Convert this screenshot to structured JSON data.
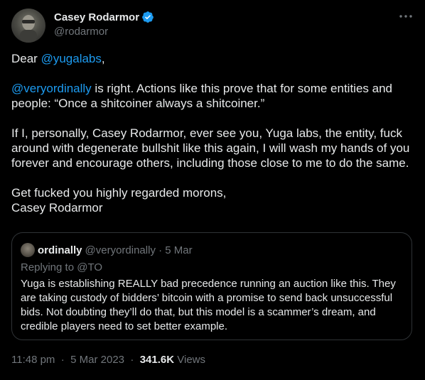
{
  "author": {
    "display_name": "Casey Rodarmor",
    "handle": "@rodarmor",
    "verified_icon": "verified-badge-icon"
  },
  "more_icon": "more-horizontal-icon",
  "tweet": {
    "salutation_prefix": "Dear ",
    "salutation_mention": "@yugalabs",
    "salutation_suffix": ",",
    "para1_mention": "@veryordinally",
    "para1_text": " is right. Actions like this prove that for some entities and people: “Once a shitcoiner always a shitcoiner.”",
    "para2": "If I, personally, Casey Rodarmor, ever see you, Yuga labs, the entity, fuck around with degenerate bullshit like this again, I will wash my hands of you forever and encourage others, including those close to me to do the same.",
    "para3_line1": "Get fucked you highly regarded morons,",
    "para3_line2": "Casey Rodarmor"
  },
  "quote": {
    "display_name": "ordinally",
    "handle": "@veryordinally",
    "separator": "·",
    "date": "5 Mar",
    "replying_to": "Replying to @TO",
    "text": "Yuga is establishing REALLY bad precedence running an auction like this. They are taking custody of bidders’ bitcoin with a promise to send back unsuccessful bids. Not doubting they’ll do that, but this model is a scammer’s dream, and credible players need to set better example."
  },
  "footer": {
    "time": "11:48 pm",
    "separator": "·",
    "date": "5 Mar 2023",
    "views_count": "341.6K",
    "views_label": "Views"
  },
  "colors": {
    "background": "#000000",
    "text": "#e7e9ea",
    "secondary": "#71767b",
    "link": "#1d9bf0",
    "border": "#2f3336"
  }
}
